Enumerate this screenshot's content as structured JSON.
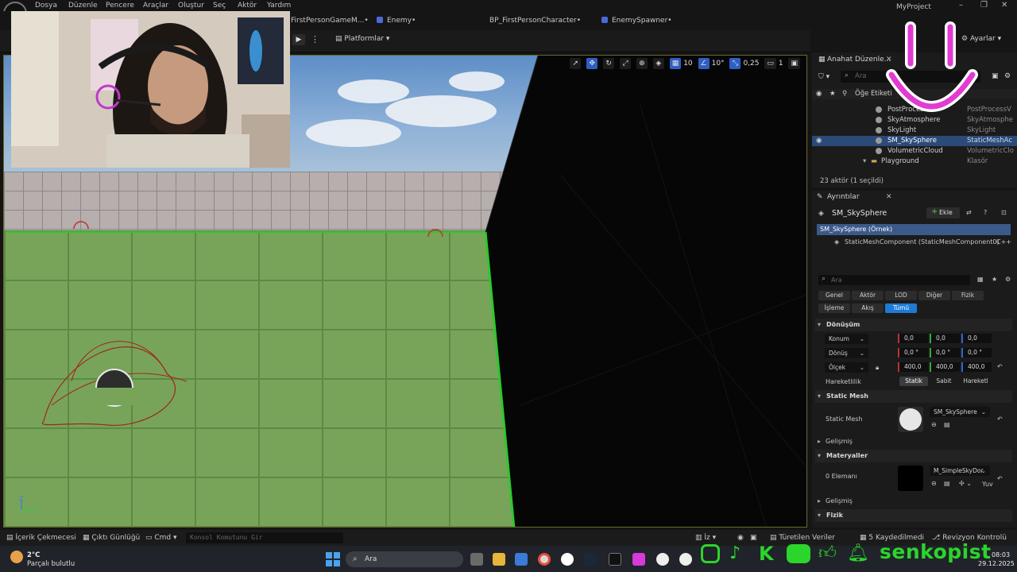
{
  "menubar": {
    "items": [
      "Dosya",
      "Düzenle",
      "Pencere",
      "Araçlar",
      "Oluştur",
      "Seç",
      "Aktör",
      "Yardım"
    ],
    "project": "MyProject"
  },
  "tabs": [
    "FirstPersonGameM...•",
    "Enemy•",
    "BP_FirstPersonCharacter•",
    "EnemySpawner•"
  ],
  "toolbar": {
    "play_icon": "play-icon",
    "platforms_label": "Platformlar",
    "settings_label": "Ayarlar"
  },
  "viewport": {
    "grid_snap": "10",
    "rotation_snap": "10°",
    "scale_snap": "0,25",
    "camera_speed": "1",
    "sky_color": "#7fa6d2",
    "floor_color": "#78a45a",
    "axis_labels": {
      "x": "X",
      "y": "Y",
      "z": "Z"
    }
  },
  "outliner": {
    "tab_label": "Anahat Düzenle...",
    "search_placeholder": "Ara",
    "column_label": "Öğe Etiketi",
    "rows": [
      {
        "name": "PostProcessVol",
        "type": "PostProcessV"
      },
      {
        "name": "SkyAtmosphere",
        "type": "SkyAtmosphe"
      },
      {
        "name": "SkyLight",
        "type": "SkyLight"
      },
      {
        "name": "SM_SkySphere",
        "type": "StaticMeshAc",
        "selected": true
      },
      {
        "name": "VolumetricCloud",
        "type": "VolumetricClo"
      },
      {
        "name": "Playground",
        "type": "Klasör"
      }
    ],
    "count": "23 aktör (1 seçildi)"
  },
  "details": {
    "tab_label": "Ayrıntılar",
    "actor_name": "SM_SkySphere",
    "add_label": "Ekle",
    "instance_label": "SM_SkySphere (Örnek)",
    "component_label": "StaticMeshComponent (StaticMeshComponent0)",
    "component_suffix": "C++",
    "search_placeholder": "Ara",
    "filter_chips_row1": [
      "Genel",
      "Aktör",
      "LOD",
      "Diğer",
      "Fizik"
    ],
    "filter_chips_row2": [
      "İşleme",
      "Akış",
      "Tümü"
    ],
    "active_chip": "Tümü",
    "transform_header": "Dönüşüm",
    "location_label": "Konum",
    "location": [
      "0,0",
      "0,0",
      "0,0"
    ],
    "rotation_label": "Dönüş",
    "rotation": [
      "0,0 °",
      "0,0 °",
      "0,0 °"
    ],
    "scale_label": "Ölçek",
    "scale": [
      "400,0",
      "400,0",
      "400,0"
    ],
    "mobility_label": "Hareketlilik",
    "mobility_options": [
      "Statik",
      "Sabit",
      "Hareketl"
    ],
    "mobility_selected": "Statik",
    "static_mesh_header": "Static Mesh",
    "static_mesh_label": "Static Mesh",
    "static_mesh_value": "SM_SkySphere",
    "advanced_label": "Gelişmiş",
    "materials_header": "Materyaller",
    "elements_label": "0 Elemanı",
    "material_value": "M_SimpleSkyDor",
    "material_extra": "Yuv",
    "advanced_label_2": "Gelişmiş",
    "physics_header": "Fizik"
  },
  "statusbar": {
    "content_drawer": "İçerik Çekmecesi",
    "output_log": "Çıktı Günlüğü",
    "cmd": "Cmd",
    "console_placeholder": "Konsol Komutunu Gir",
    "izle": "İz",
    "derived_data": "Türetilen Veriler",
    "saved": "5 Kaydedilmedi",
    "revision": "Revizyon Kontrolü"
  },
  "taskbar": {
    "temp": "2°C",
    "weather": "Parçalı bulutlu",
    "search": "Ara",
    "time": "08:03",
    "date": "29.12.2025"
  },
  "overlay": {
    "handle": "senkopist",
    "brand_color": "#2bd52b"
  }
}
